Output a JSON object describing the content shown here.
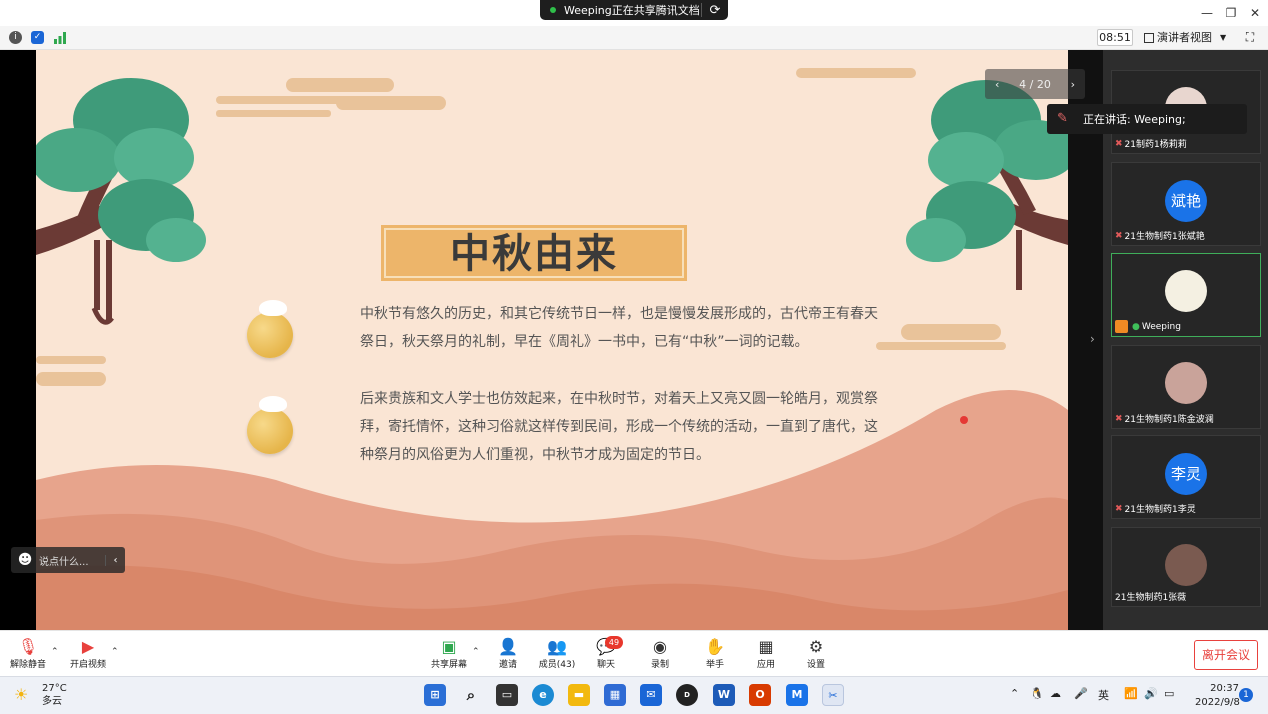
{
  "share_banner": {
    "text": "Weeping正在共享腾讯文档"
  },
  "toolbar": {
    "time": "08:51",
    "view_label": "演讲者视图"
  },
  "slide": {
    "page_indicator": "4 / 20",
    "title": "中秋由来",
    "paragraph1": "中秋节有悠久的历史，和其它传统节日一样，也是慢慢发展形成的，古代帝王有春天祭日，秋天祭月的礼制，早在《周礼》一书中，已有“中秋”一词的记载。",
    "paragraph2": "后来贵族和文人学士也仿效起来，在中秋时节，对着天上又亮又圆一轮皓月，观赏祭拜，寄托情怀，这种习俗就这样传到民间，形成一个传统的活动，一直到了唐代，这种祭月的风俗更为人们重视，中秋节才成为固定的节日。"
  },
  "speaking": {
    "text": "正在讲话: Weeping;"
  },
  "chat_float": {
    "placeholder": "说点什么..."
  },
  "participants": [
    {
      "name": "21制药1杨莉莉",
      "avatar": "photo"
    },
    {
      "name": "21生物制药1张斌艳",
      "avatar_text": "斌艳"
    },
    {
      "name": "Weeping",
      "avatar": "photo",
      "active": true
    },
    {
      "name": "21生物制药1陈金波澜",
      "avatar": "photo"
    },
    {
      "name": "21生物制药1李灵",
      "avatar_text": "李灵"
    },
    {
      "name": "21生物制药1张薇",
      "avatar": "photo"
    }
  ],
  "controls": {
    "unmute": "解除静音",
    "start_video": "开启视频",
    "share_screen": "共享屏幕",
    "invite": "邀请",
    "members": "成员(43)",
    "chat": "聊天",
    "chat_badge": "49",
    "record": "录制",
    "raise_hand": "举手",
    "apps": "应用",
    "settings": "设置",
    "leave": "离开会议"
  },
  "taskbar": {
    "temperature": "27°C",
    "weather": "多云",
    "ime": "英",
    "time": "20:37",
    "date": "2022/9/8",
    "notif_count": "1"
  },
  "colors": {
    "slide_bg": "#fae5d4",
    "plaque": "#edb56a",
    "accent_blue": "#1a73e8",
    "leave_red": "#e8413d"
  }
}
